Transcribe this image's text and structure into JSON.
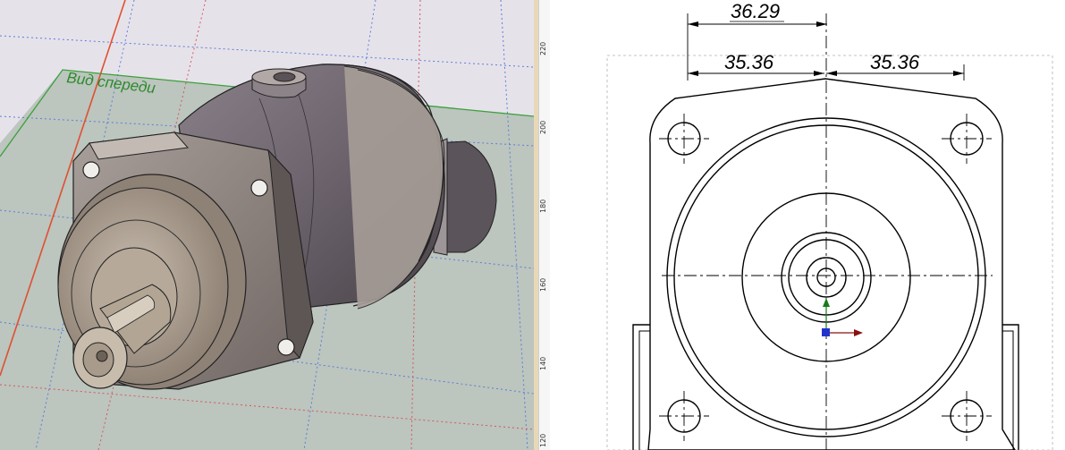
{
  "viewport3d": {
    "view_label": "Вид спереди",
    "colors": {
      "sky": "#e6e2ea",
      "ground": "#bcc5be",
      "plane_edge": "#3aa13a",
      "red_axis": "#e05030",
      "grid_blue": "#5a7fd8",
      "grid_red": "#d25a5a"
    }
  },
  "ruler": {
    "ticks": [
      "220",
      "200",
      "180",
      "160",
      "140",
      "120"
    ]
  },
  "drawing": {
    "dim_total": "36.29",
    "dim_left": "35.36",
    "dim_right": "35.36",
    "colors": {
      "line": "#000000",
      "axis_x": "#8a1010",
      "axis_y": "#1a7a1a",
      "origin": "#2233cc"
    }
  }
}
